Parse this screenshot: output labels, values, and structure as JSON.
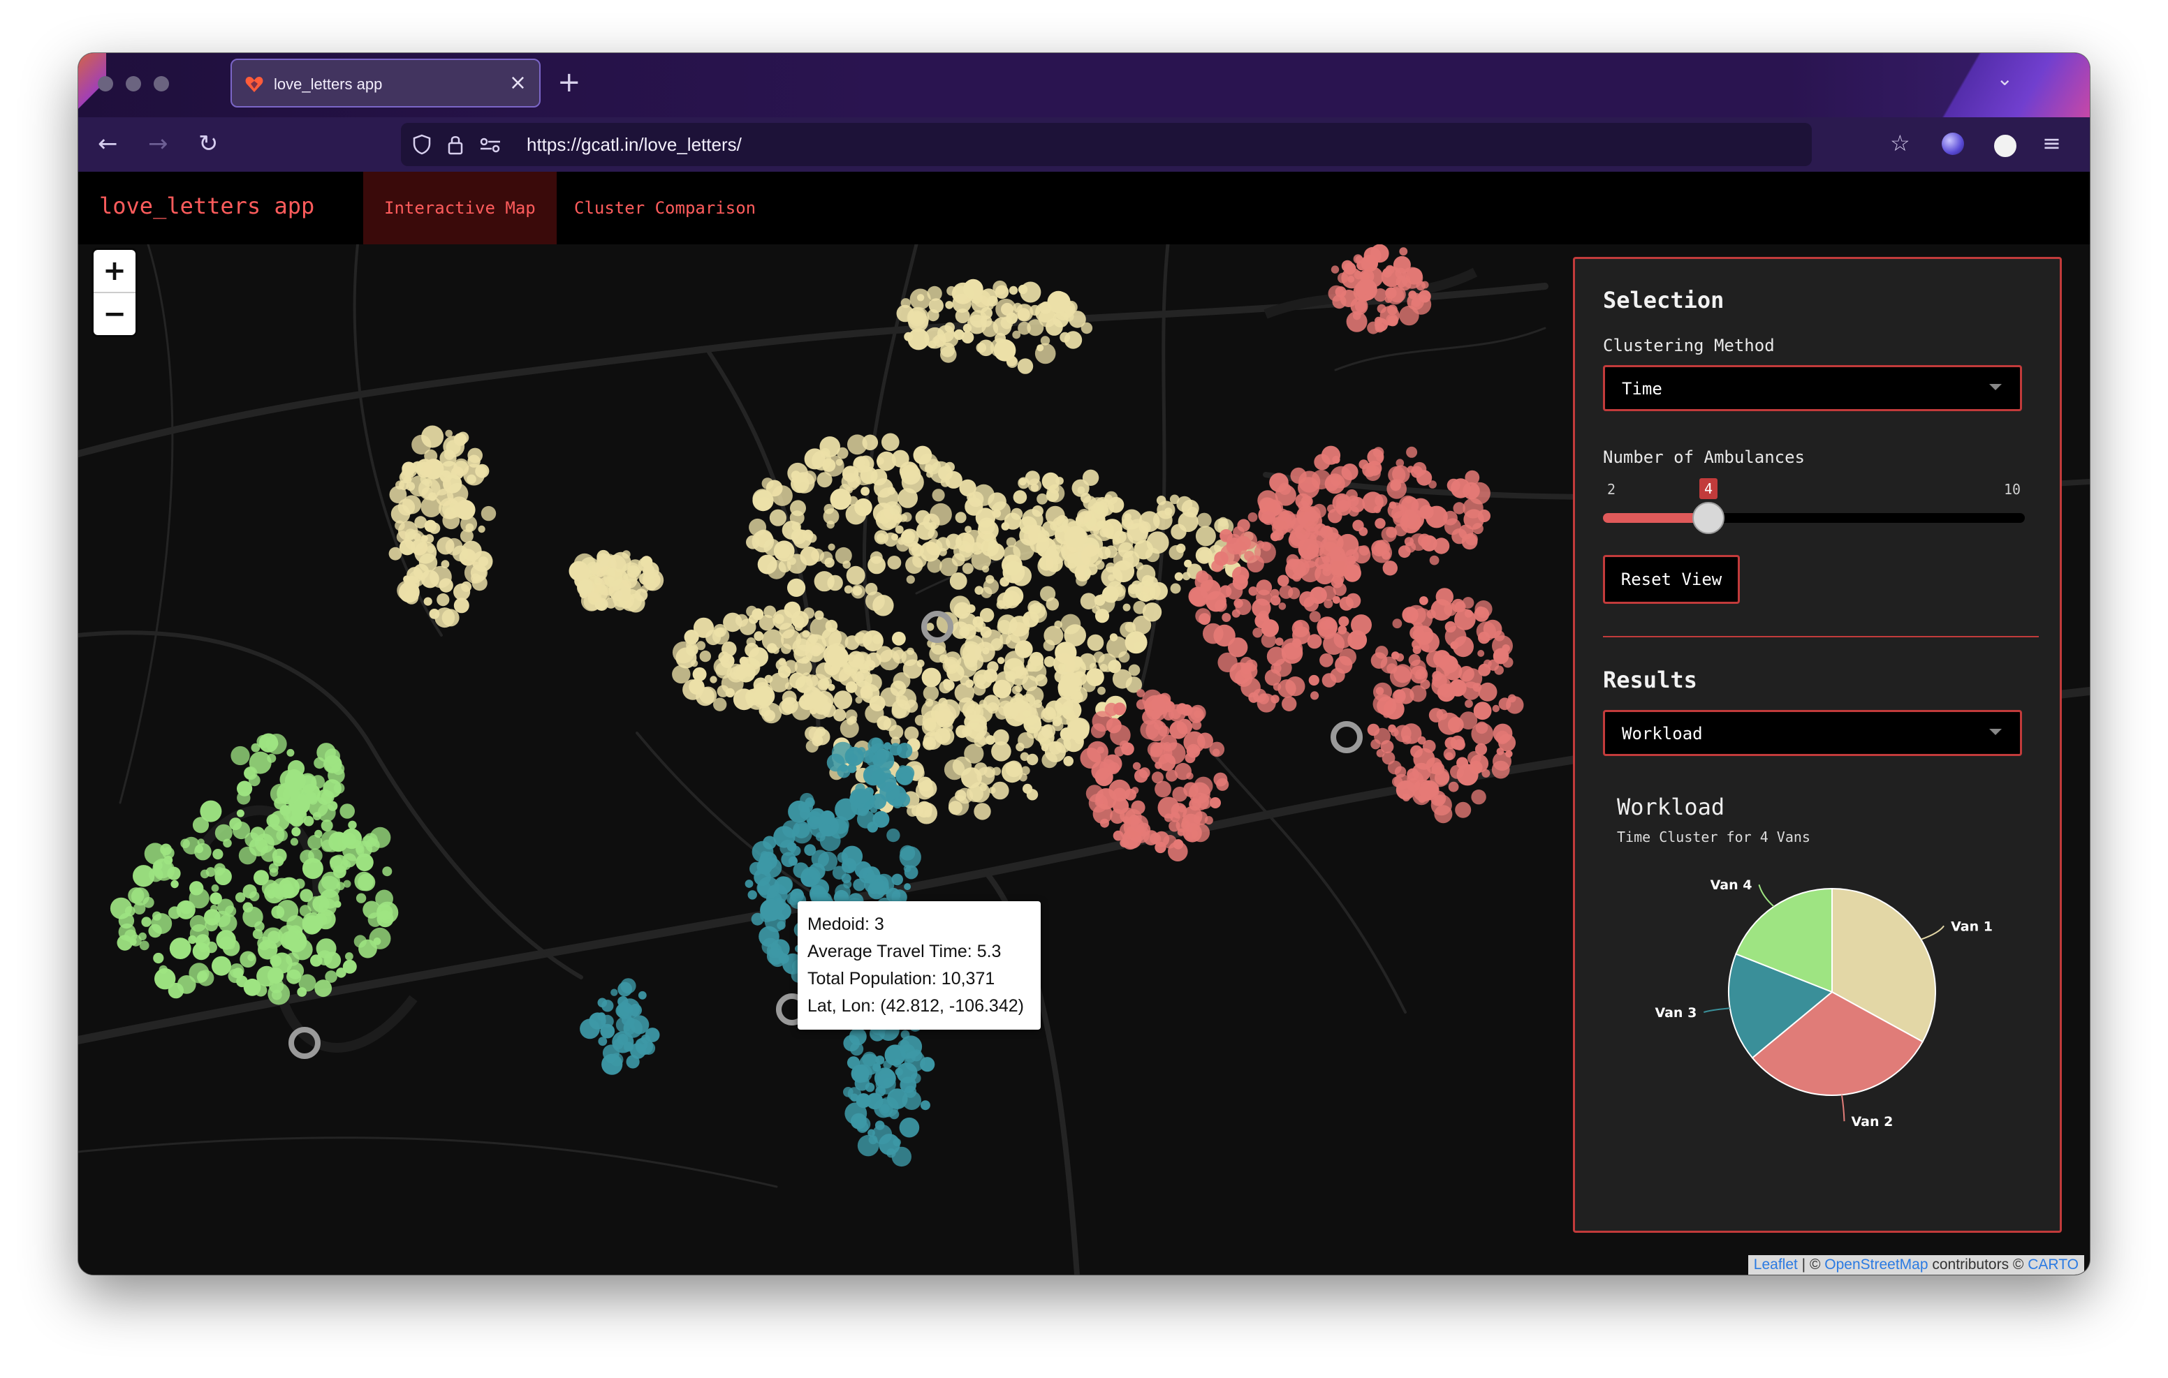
{
  "browser": {
    "tab_title": "love_letters app",
    "url": "https://gcatl.in/love_letters/"
  },
  "app": {
    "brand": "love_letters app",
    "tabs": [
      {
        "label": "Interactive Map",
        "active": true
      },
      {
        "label": "Cluster Comparison",
        "active": false
      }
    ]
  },
  "map": {
    "zoom_in": "+",
    "zoom_out": "−",
    "tooltip": {
      "medoid": "Medoid: 3",
      "travel": "Average Travel Time: 5.3",
      "population": "Total Population: 10,371",
      "latlon": "Lat, Lon: (42.812, -106.342)"
    },
    "attribution": {
      "leaflet": "Leaflet",
      "sep1": " | © ",
      "osm": "OpenStreetMap",
      "mid": " contributors © ",
      "carto": "CARTO"
    },
    "colors": {
      "van1": "#ece0a8",
      "van2": "#e57a76",
      "van3": "#3d98a6",
      "van4": "#9ee482",
      "background": "#0e0e0e"
    }
  },
  "panel": {
    "selection_heading": "Selection",
    "clustering_label": "Clustering Method",
    "clustering_value": "Time",
    "ambulances_label": "Number of Ambulances",
    "slider": {
      "min": 2,
      "max": 10,
      "value": 4,
      "min_label": "2",
      "max_label": "10",
      "value_label": "4"
    },
    "reset_button": "Reset View",
    "results_heading": "Results",
    "results_value": "Workload"
  },
  "chart_data": {
    "type": "pie",
    "title": "Workload",
    "subtitle": "Time Cluster for 4 Vans",
    "labels": [
      "Van 1",
      "Van 2",
      "Van 3",
      "Van 4"
    ],
    "values": [
      33,
      31,
      17,
      19
    ],
    "colors": [
      "#e3d7a6",
      "#e07c78",
      "#3a8f99",
      "#9ee482"
    ]
  }
}
